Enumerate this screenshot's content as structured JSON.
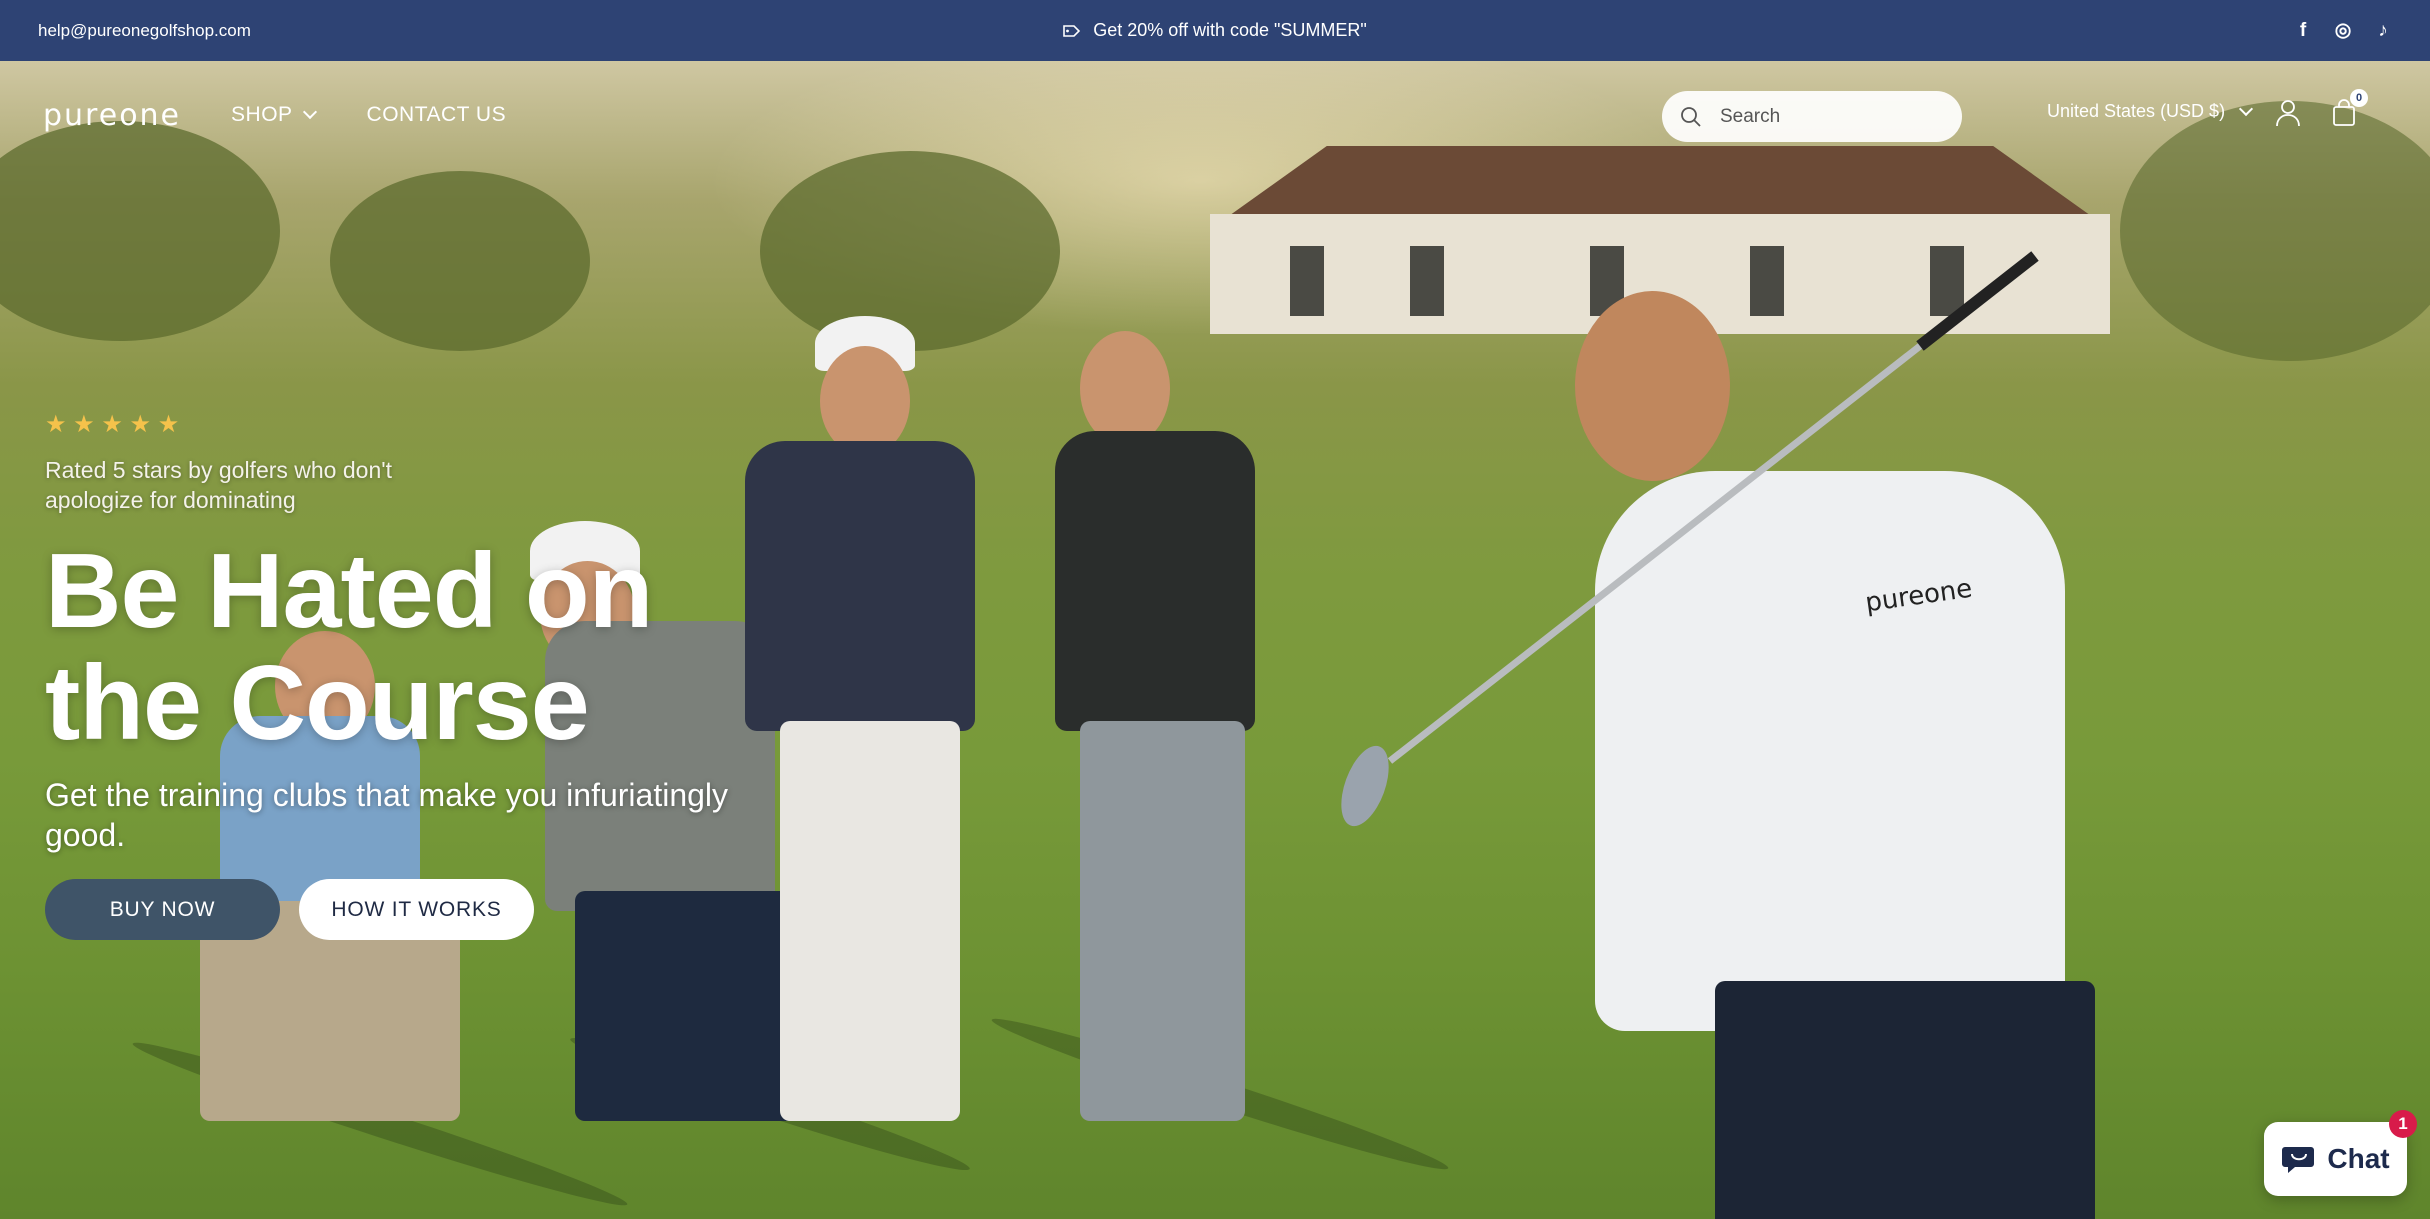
{
  "announcement": {
    "email": "help@pureonegolfshop.com",
    "promo_text": "Get 20% off with code \"SUMMER\"",
    "social": [
      "f",
      "◎",
      "♪"
    ]
  },
  "header": {
    "logo_text": "pureone",
    "nav": [
      {
        "label": "SHOP"
      },
      {
        "label": "CONTACT US"
      }
    ],
    "search_placeholder": "Search",
    "country": "United States (USD $)",
    "cart_count": "0"
  },
  "hero": {
    "stars": "★ ★ ★ ★ ★",
    "star_count": 5,
    "rating_text": "Rated 5 stars by golfers who don't apologize for dominating",
    "headline": "Be Hated on the Course",
    "subheadline": "Get the training clubs that make you infuriatingly good.",
    "primary_button": "BUY NOW",
    "secondary_button": "HOW IT WORKS",
    "shirt_logo": "pureone"
  },
  "chat": {
    "label": "Chat",
    "badge": "1"
  },
  "colors": {
    "announcement_bg": "#2e4374",
    "star": "#f5c24b",
    "primary_button": "#3f5468",
    "chat_badge": "#d81b4a"
  }
}
